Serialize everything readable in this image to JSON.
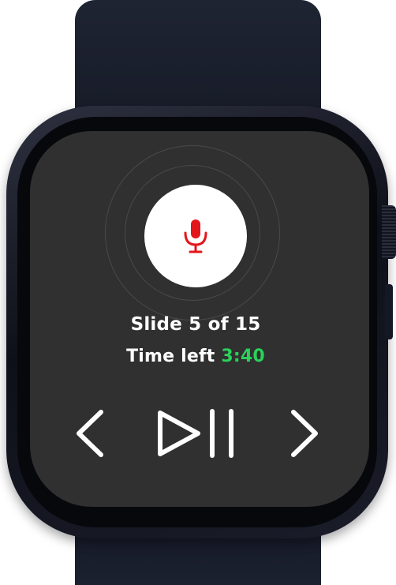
{
  "device": "smartwatch",
  "recorder": {
    "icon": "microphone-icon",
    "accent_color": "#e3161b"
  },
  "status": {
    "slide_text": "Slide 5 of 15",
    "time_label": "Time left",
    "time_value": "3:40",
    "time_color": "#2ad15a"
  },
  "controls": {
    "previous_icon": "chevron-left-icon",
    "play_pause_icon": "play-pause-icon",
    "next_icon": "chevron-right-icon"
  }
}
